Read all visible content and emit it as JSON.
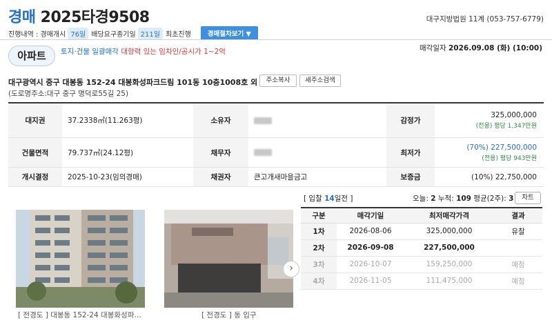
{
  "header": {
    "case_kind": "경매",
    "case_number": "2025타경9508",
    "court": "대구지방법원 11계 (053-757-6779)",
    "progress_label": "진행내역 : 경매개시",
    "progress_days": "76일",
    "dividend_label": "배당요구종기일",
    "dividend_days": "211일",
    "first_status": "최초진행",
    "procedure_button": "경매절차보기 ▼"
  },
  "property": {
    "type": "아파트",
    "desc_bulk": "토지·건물 일괄매각",
    "desc_warning": "대항력 있는 임차인/공시가 1~2억",
    "sale_date_label": "매각일자",
    "sale_date": "2026.09.08 (화) (10:00)",
    "address": "대구광역시 중구 대봉동 152-24 대봉화성파크드림 101동 10층1008호 외 1필지",
    "road_address": "(도로명주소:대구 중구 명덕로55길 25)",
    "copy_address_btn": "주소복사",
    "new_address_btn": "새주소검색"
  },
  "info": {
    "land_rights_label": "대지권",
    "land_rights": "37.2338㎡(11.263평)",
    "owner_label": "소유자",
    "appraisal_label": "감정가",
    "appraisal": "325,000,000",
    "appraisal_sub": "(전용) 평당 1,347만원",
    "building_area_label": "건물면적",
    "building_area": "79.737㎡(24.12평)",
    "debtor_label": "채무자",
    "minimum_label": "최저가",
    "minimum": "(70%) 227,500,000",
    "minimum_sub": "(전용) 평당 943만원",
    "commence_label": "개시결정",
    "commence": "2025-10-23(임의경매)",
    "creditor_label": "채권자",
    "creditor": "큰고개새마을금고",
    "deposit_label": "보증금",
    "deposit": "(10%) 22,750,000"
  },
  "bid": {
    "prefix": "[ 입찰 ",
    "days": "14",
    "suffix": "일전 ]",
    "today_label": "오늘:",
    "today": "2",
    "total_label": "누적:",
    "total": "109",
    "avg_label": "평균(2주):",
    "avg": "3",
    "chart_btn": "차트"
  },
  "photos": [
    {
      "caption_tag": "[ 전경도 ]",
      "caption": "대봉동 152-24 대봉화성파…"
    },
    {
      "caption_tag": "[ 전경도 ]",
      "caption": "동 입구"
    }
  ],
  "rounds": {
    "headers": [
      "구분",
      "매각기일",
      "최저매각가격",
      "결과"
    ],
    "rows": [
      {
        "round": "1차",
        "date": "2026-08-06",
        "price": "325,000,000",
        "result": "유찰"
      },
      {
        "round": "2차",
        "date": "2026-09-08",
        "price": "227,500,000",
        "result": ""
      },
      {
        "round": "3차",
        "date": "2026-10-07",
        "price": "159,250,000",
        "result": "예정"
      },
      {
        "round": "4차",
        "date": "2026-11-05",
        "price": "111,475,000",
        "result": "예정"
      }
    ]
  }
}
